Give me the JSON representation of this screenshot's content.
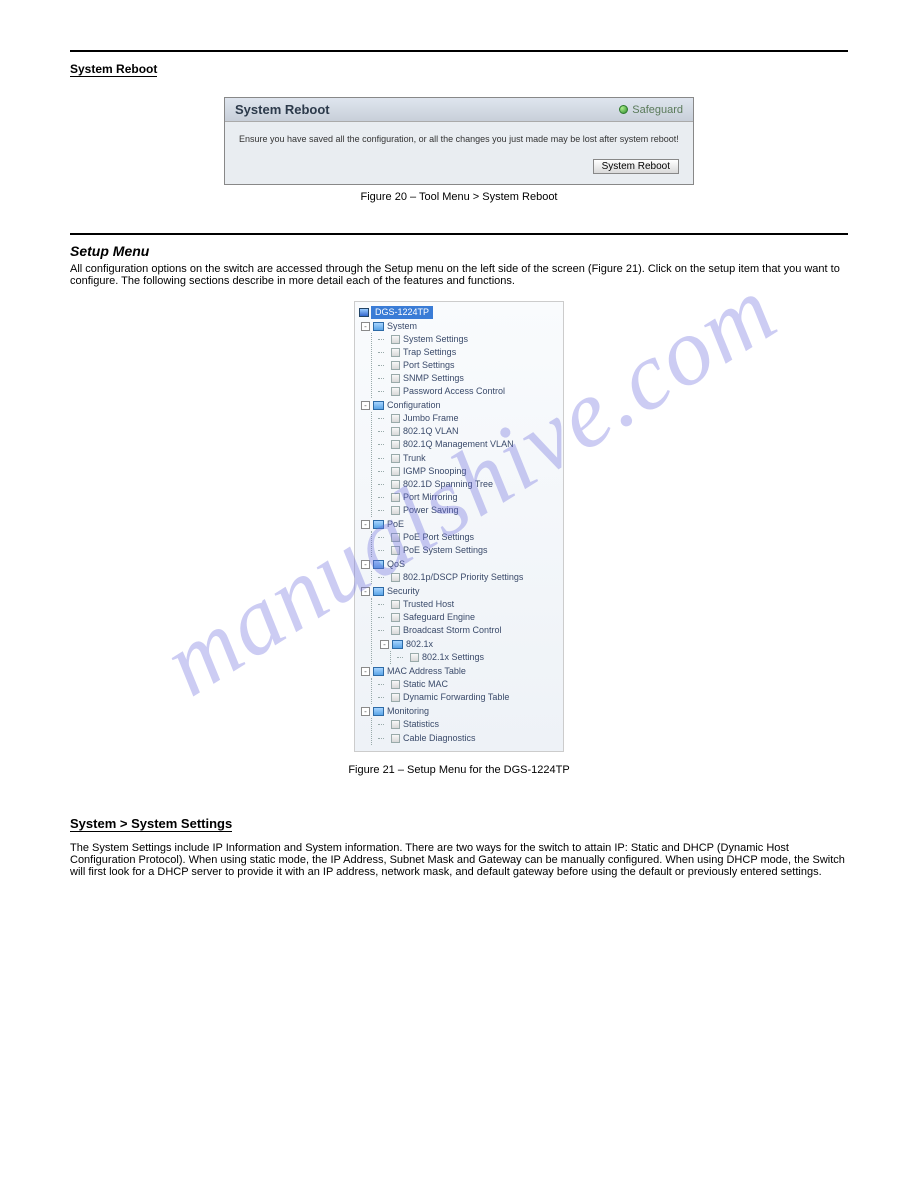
{
  "top_section_title": "System Reboot",
  "watermark": "manualshive.com",
  "reboot_panel": {
    "title": "System Reboot",
    "safeguard_label": "Safeguard",
    "message": "Ensure you have saved all the configuration, or all the changes you just made may be lost after system reboot!",
    "button_label": "System Reboot"
  },
  "fig1_caption": "Figure 20 – Tool Menu > System Reboot",
  "setup_heading": "Setup Menu",
  "setup_desc": "All configuration options on the switch are accessed through the Setup menu on the left side of the screen (Figure 21). Click on the setup item that you want to configure. The following sections describe in more detail each of the features and functions.",
  "tree": {
    "root": "DGS-1224TP",
    "folders": [
      {
        "label": "System",
        "children": [
          "System Settings",
          "Trap Settings",
          "Port Settings",
          "SNMP Settings",
          "Password Access Control"
        ]
      },
      {
        "label": "Configuration",
        "children": [
          "Jumbo Frame",
          "802.1Q VLAN",
          "802.1Q Management VLAN",
          "Trunk",
          "IGMP Snooping",
          "802.1D Spanning Tree",
          "Port Mirroring",
          "Power Saving"
        ]
      },
      {
        "label": "PoE",
        "children": [
          "PoE Port Settings",
          "PoE System Settings"
        ]
      },
      {
        "label": "QoS",
        "children": [
          "802.1p/DSCP Priority Settings"
        ]
      },
      {
        "label": "Security",
        "children": [
          "Trusted Host",
          "Safeguard Engine",
          "Broadcast Storm Control"
        ],
        "subfolders": [
          {
            "label": "802.1x",
            "children": [
              "802.1x Settings"
            ]
          }
        ]
      },
      {
        "label": "MAC Address Table",
        "children": [
          "Static MAC",
          "Dynamic Forwarding Table"
        ]
      },
      {
        "label": "Monitoring",
        "children": [
          "Statistics",
          "Cable Diagnostics"
        ]
      }
    ]
  },
  "fig2_caption": "Figure 21 – Setup Menu for the DGS-1224TP",
  "sys_settings_heading": "System > System Settings",
  "sys_settings_desc": "The System Settings include IP Information and System information. There are two ways for the switch to attain IP: Static and DHCP (Dynamic Host Configuration Protocol). When using static mode, the IP Address, Subnet Mask and Gateway can be manually configured. When using DHCP mode, the Switch will first look for a DHCP server to provide it with an IP address, network mask, and default gateway before using the default or previously entered settings."
}
